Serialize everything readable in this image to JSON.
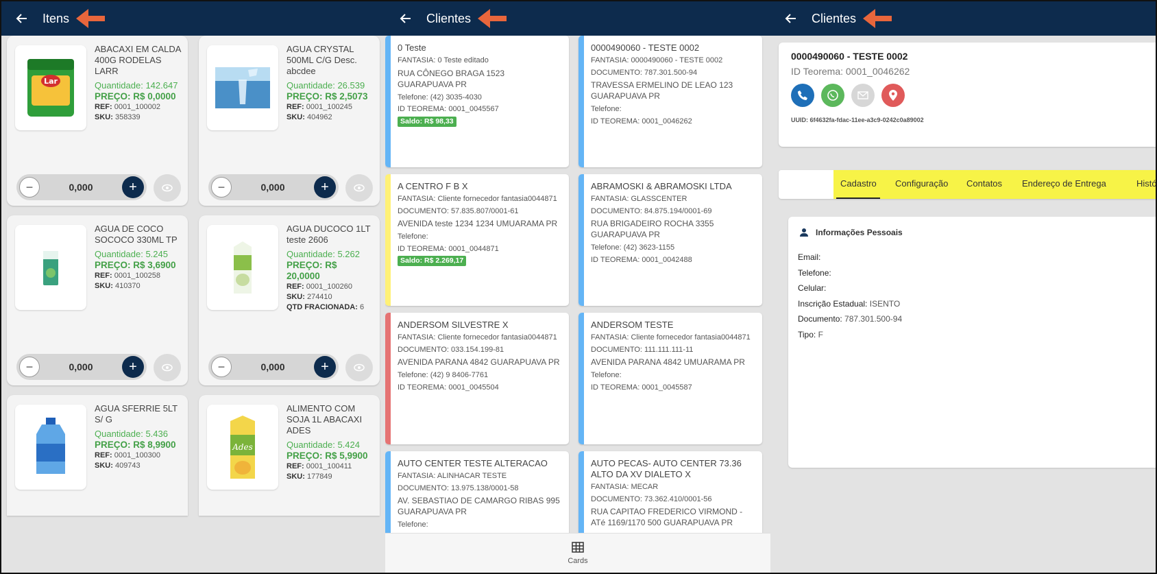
{
  "panels": {
    "items": {
      "title": "Itens",
      "products": [
        {
          "name": "ABACAXI EM CALDA 400G RODELAS LARR",
          "qty": "Quantidade: 142.647",
          "price": "PREÇO: R$ 0,0000",
          "ref_label": "REF:",
          "ref": "0001_100002",
          "sku_label": "SKU:",
          "sku": "358339",
          "extra_label": "",
          "extra": "",
          "stepper": "0,000",
          "img": "can-icon"
        },
        {
          "name": "AGUA CRYSTAL 500ML C/G Desc. abcdee",
          "qty": "Quantidade: 26.539",
          "price": "PREÇO: R$ 2,5073",
          "ref_label": "REF:",
          "ref": "0001_100245",
          "sku_label": "SKU:",
          "sku": "404962",
          "extra_label": "",
          "extra": "",
          "stepper": "0,000",
          "img": "water-glass-icon"
        },
        {
          "name": "AGUA DE COCO SOCOCO 330ML TP",
          "qty": "Quantidade: 5.245",
          "price": "PREÇO: R$ 3,6900",
          "ref_label": "REF:",
          "ref": "0001_100258",
          "sku_label": "SKU:",
          "sku": "410370",
          "extra_label": "",
          "extra": "",
          "stepper": "0,000",
          "img": "juice-box-icon"
        },
        {
          "name": "AGUA DUCOCO 1LT teste 2606",
          "qty": "Quantidade: 5.262",
          "price": "PREÇO: R$ 20,0000",
          "ref_label": "REF:",
          "ref": "0001_100260",
          "sku_label": "SKU:",
          "sku": "274410",
          "extra_label": "QTD FRACIONADA:",
          "extra": "6",
          "stepper": "0,000",
          "img": "carton-icon"
        },
        {
          "name": "AGUA SFERRIE 5LT S/ G",
          "qty": "Quantidade: 5.436",
          "price": "PREÇO: R$ 8,9900",
          "ref_label": "REF:",
          "ref": "0001_100300",
          "sku_label": "SKU:",
          "sku": "409743",
          "extra_label": "",
          "extra": "",
          "stepper": "",
          "img": "water-jug-icon"
        },
        {
          "name": "ALIMENTO COM SOJA 1L ABACAXI ADES",
          "qty": "Quantidade: 5.424",
          "price": "PREÇO: R$ 5,9900",
          "ref_label": "REF:",
          "ref": "0001_100411",
          "sku_label": "SKU:",
          "sku": "177849",
          "extra_label": "",
          "extra": "",
          "stepper": "",
          "img": "ades-carton-icon"
        }
      ]
    },
    "clients": {
      "title": "Clientes",
      "nav_label": "Cards",
      "cards": [
        {
          "name": "0 Teste",
          "lines": [
            "FANTASIA: 0 Teste editado"
          ],
          "address": "RUA CÔNEGO BRAGA 1523 GUARAPUAVA PR",
          "phone": "Telefone: (42) 3035-4030",
          "id": "ID TEOREMA: 0001_0045567",
          "saldo": "Saldo: R$ 98,33",
          "bar": "#64b5f6"
        },
        {
          "name": "0000490060 - TESTE 0002",
          "lines": [
            "FANTASIA: 0000490060 - TESTE 0002",
            "DOCUMENTO: 787.301.500-94"
          ],
          "address": "TRAVESSA ERMELINO DE LEAO 123 GUARAPUAVA PR",
          "phone": "Telefone:",
          "id": "ID TEOREMA: 0001_0046262",
          "saldo": "",
          "bar": "#64b5f6"
        },
        {
          "name": "A CENTRO  F B X",
          "lines": [
            "FANTASIA: Cliente fornecedor fantasia0044871",
            "DOCUMENTO: 57.835.807/0001-61"
          ],
          "address": "AVENIDA teste 1234 1234 UMUARAMA PR",
          "phone": "Telefone:",
          "id": "ID TEOREMA: 0001_0044871",
          "saldo": "Saldo: R$ 2.269,17",
          "bar": "#fff176"
        },
        {
          "name": "ABRAMOSKI & ABRAMOSKI LTDA",
          "lines": [
            "FANTASIA: GLASSCENTER",
            "DOCUMENTO: 84.875.194/0001-69"
          ],
          "address": "RUA BRIGADEIRO ROCHA 3355 GUARAPUAVA PR",
          "phone": "Telefone: (42) 3623-1155",
          "id": "ID TEOREMA: 0001_0042488",
          "saldo": "",
          "bar": "#64b5f6"
        },
        {
          "name": "ANDERSOM SILVESTRE X",
          "lines": [
            "FANTASIA: Cliente fornecedor fantasia0044871",
            "DOCUMENTO: 033.154.199-81"
          ],
          "address": "AVENIDA PARANA 4842 GUARAPUAVA PR",
          "phone": "Telefone: (42) 9 8406-7761",
          "id": "ID TEOREMA: 0001_0045504",
          "saldo": "",
          "bar": "#e57373"
        },
        {
          "name": "ANDERSOM TESTE",
          "lines": [
            "FANTASIA: Cliente fornecedor fantasia0044871",
            "DOCUMENTO: 111.111.111-11"
          ],
          "address": "AVENIDA PARANA 4842 UMUARAMA PR",
          "phone": "Telefone:",
          "id": "ID TEOREMA: 0001_0045587",
          "saldo": "",
          "bar": "#64b5f6"
        },
        {
          "name": "AUTO CENTER TESTE ALTERACAO",
          "lines": [
            "FANTASIA: ALINHACAR TESTE",
            "DOCUMENTO: 13.975.138/0001-58"
          ],
          "address": "AV. SEBASTIAO DE CAMARGO RIBAS 995 GUARAPUAVA PR",
          "phone": "Telefone:",
          "id": "",
          "saldo": "",
          "bar": "#64b5f6"
        },
        {
          "name": "AUTO PECAS- AUTO CENTER 73.36 ALTO DA XV DIALETO X",
          "lines": [
            "FANTASIA: MECAR",
            "DOCUMENTO: 73.362.410/0001-56"
          ],
          "address": "RUA CAPITAO FREDERICO VIRMOND - ATé 1169/1170 500 GUARAPUAVA PR",
          "phone": "",
          "id": "",
          "saldo": "",
          "bar": "#64b5f6"
        }
      ]
    },
    "detail": {
      "title": "Clientes",
      "name": "0000490060 - TESTE 0002",
      "id_teorema": "ID Teorema: 0001_0046262",
      "uuid": "UUID: 6f4632fa-fdac-11ee-a3c9-0242c0a89002",
      "tabs": [
        "Cadastro",
        "Configuração",
        "Contatos",
        "Endereço de Entrega",
        "Histó"
      ],
      "section_title": "Informações Pessoais",
      "fields": [
        {
          "label": "Email:",
          "value": ""
        },
        {
          "label": "Telefone:",
          "value": ""
        },
        {
          "label": "Celular:",
          "value": ""
        },
        {
          "label": "Inscrição Estadual:",
          "value": "ISENTO"
        },
        {
          "label": "Documento:",
          "value": "787.301.500-94"
        },
        {
          "label": "Tipo:",
          "value": "F"
        }
      ]
    }
  },
  "colors": {
    "topbar": "#0d2b4d",
    "accent_arrow": "#e8663c",
    "price_green": "#43a047",
    "highlight": "#f7f347"
  }
}
